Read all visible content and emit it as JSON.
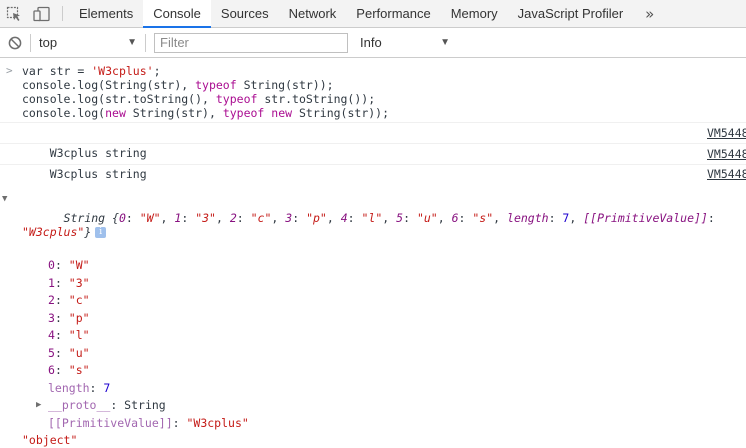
{
  "tabs": [
    {
      "label": "Elements",
      "active": false
    },
    {
      "label": "Console",
      "active": true
    },
    {
      "label": "Sources",
      "active": false
    },
    {
      "label": "Network",
      "active": false
    },
    {
      "label": "Performance",
      "active": false
    },
    {
      "label": "Memory",
      "active": false
    },
    {
      "label": "JavaScript Profiler",
      "active": false
    }
  ],
  "more_tabs_glyph": "»",
  "toolbar": {
    "context": "top",
    "filter_placeholder": "Filter",
    "level": "Info"
  },
  "input_code": {
    "line1": {
      "a": "var str = ",
      "b": "'W3cplus'",
      "c": ";"
    },
    "line2": {
      "a": "console.log(String(str), ",
      "b": "typeof",
      "c": " String(str));"
    },
    "line3": {
      "a": "console.log(str.toString(), ",
      "b": "typeof",
      "c": " str.toString());"
    },
    "line4": {
      "a": "console.log(",
      "b": "new",
      "c": " String(str), ",
      "d": "typeof",
      "e": " ",
      "f": "new",
      "g": " String(str));"
    }
  },
  "log1": {
    "text": "W3cplus string",
    "source": "VM5448"
  },
  "log2": {
    "text": "W3cplus string",
    "source": "VM5448"
  },
  "obj_log": {
    "source": "VM5448",
    "class_name": "String",
    "preview": {
      "open": " {",
      "items": [
        {
          "key": "0",
          "val": "\"W\""
        },
        {
          "key": "1",
          "val": "\"3\""
        },
        {
          "key": "2",
          "val": "\"c\""
        },
        {
          "key": "3",
          "val": "\"p\""
        },
        {
          "key": "4",
          "val": "\"l\""
        },
        {
          "key": "5",
          "val": "\"u\""
        },
        {
          "key": "6",
          "val": "\"s\""
        }
      ],
      "length_key": "length",
      "length_val": "7",
      "primitive_key": "[[PrimitiveValue]]",
      "primitive_val": "\"W3cplus\"",
      "close": "}"
    },
    "info_badge": "i",
    "properties": [
      {
        "key": "0",
        "val": "\"W\""
      },
      {
        "key": "1",
        "val": "\"3\""
      },
      {
        "key": "2",
        "val": "\"c\""
      },
      {
        "key": "3",
        "val": "\"p\""
      },
      {
        "key": "4",
        "val": "\"l\""
      },
      {
        "key": "5",
        "val": "\"u\""
      },
      {
        "key": "6",
        "val": "\"s\""
      }
    ],
    "length_key": "length",
    "length_val": "7",
    "proto_key": "__proto__",
    "proto_val": "String",
    "primitive_key": "[[PrimitiveValue]]",
    "primitive_val": "\"W3cplus\"",
    "typeof_result": "\"object\""
  },
  "colors": {
    "accent": "#1a73e8",
    "keyword": "#aa0d91",
    "string": "#c41a16",
    "number": "#1c00cf",
    "property": "#881280"
  },
  "icons": [
    "inspect-element-icon",
    "device-toggle-icon",
    "clear-console-icon",
    "dropdown-caret-icon",
    "expand-triangle-icon",
    "info-icon"
  ]
}
